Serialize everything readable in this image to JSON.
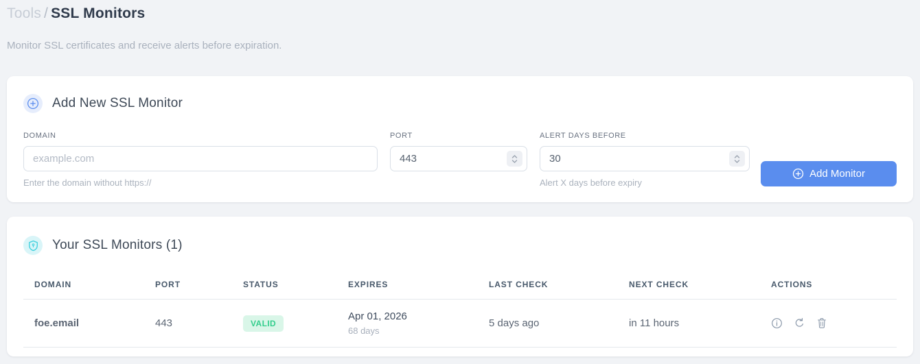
{
  "breadcrumb": {
    "section": "Tools",
    "separator": "/",
    "current": "SSL Monitors"
  },
  "subtitle": "Monitor SSL certificates and receive alerts before expiration.",
  "add_monitor_card": {
    "title": "Add New SSL Monitor",
    "icon": "plus-circle-icon",
    "fields": {
      "domain": {
        "label": "DOMAIN",
        "placeholder": "example.com",
        "value": "",
        "helper": "Enter the domain without https://"
      },
      "port": {
        "label": "PORT",
        "value": "443"
      },
      "alert_days": {
        "label": "ALERT DAYS BEFORE",
        "value": "30",
        "helper": "Alert X days before expiry"
      }
    },
    "submit_label": "Add Monitor"
  },
  "monitors_card": {
    "title": "Your SSL Monitors (1)",
    "icon": "shield-icon",
    "table": {
      "columns": [
        "DOMAIN",
        "PORT",
        "STATUS",
        "EXPIRES",
        "LAST CHECK",
        "NEXT CHECK",
        "ACTIONS"
      ],
      "rows": [
        {
          "domain": "foe.email",
          "port": "443",
          "status": "VALID",
          "expires_date": "Apr 01, 2026",
          "expires_days": "68 days",
          "last_check": "5 days ago",
          "next_check": "in 11 hours",
          "actions": [
            "info-icon",
            "refresh-icon",
            "trash-icon"
          ]
        }
      ]
    }
  },
  "colors": {
    "accent_blue": "#5a8dee",
    "success_green": "#34ce8d",
    "success_bg": "#d9f6e8",
    "cyan_icon": "#3bcfdd",
    "page_bg": "#f1f3f6",
    "card_bg": "#ffffff"
  }
}
